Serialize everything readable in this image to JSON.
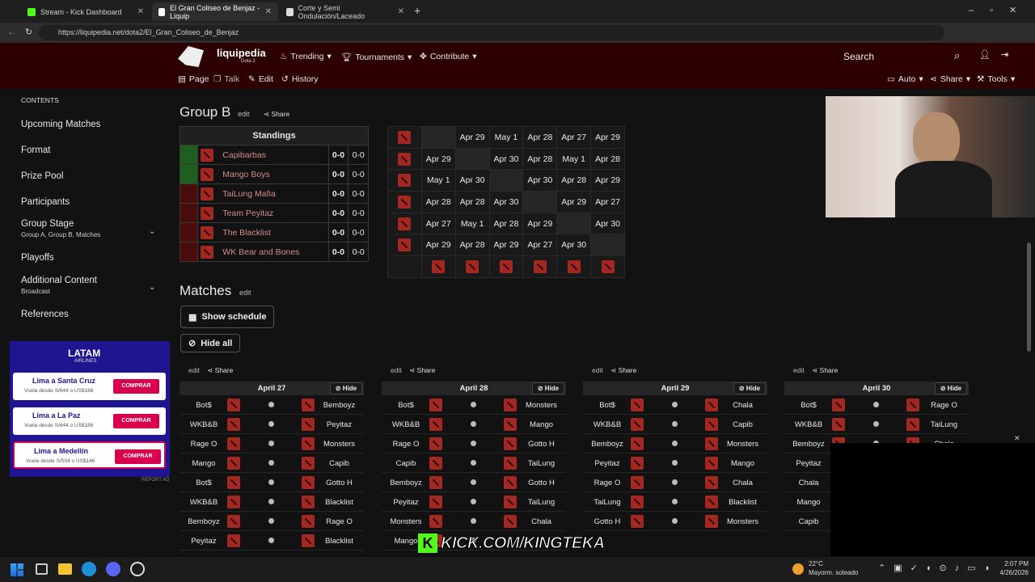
{
  "browser": {
    "tabs": [
      "Stream - Kick Dashboard",
      "El Gran Coliseo de Benjaz - Liquip",
      "Corte y Semi Ondulación/Laceado"
    ],
    "url": "https://liquipedia.net/dota2/El_Gran_Coliseo_de_Benjaz"
  },
  "header": {
    "logo": "liquipedia",
    "logo_sub": "Dota 2",
    "nav": [
      "Trending",
      "Tournaments",
      "Contribute"
    ],
    "search": "Search",
    "page_tabs": [
      "Page",
      "Talk",
      "Edit",
      "History"
    ],
    "right_tools": [
      "Auto",
      "Share",
      "Tools"
    ]
  },
  "sidebar": {
    "title": "CONTENTS",
    "items": [
      {
        "label": "Upcoming Matches"
      },
      {
        "label": "Format"
      },
      {
        "label": "Prize Pool"
      },
      {
        "label": "Participants"
      },
      {
        "label": "Group Stage",
        "sub": "Group A, Group B, Matches"
      },
      {
        "label": "Playoffs"
      },
      {
        "label": "Additional Content",
        "sub": "Broadcast"
      },
      {
        "label": "References"
      }
    ]
  },
  "ad": {
    "brand": "LATAM",
    "brand_sub": "AIRLINES",
    "rows": [
      {
        "name": "Lima a Santa Cruz",
        "price": "Vuela desde S/644 o US$186",
        "cta": "COMPRAR"
      },
      {
        "name": "Lima a La Paz",
        "price": "Vuela desde S/644 o US$186",
        "cta": "COMPRAR"
      },
      {
        "name": "Lima a Medellín",
        "price": "Vuela desde S/504 o US$146",
        "cta": "COMPRAR"
      }
    ],
    "report": "REPORT AD"
  },
  "group": {
    "title": "Group B",
    "edit": "edit",
    "share": "Share",
    "standings_header": "Standings",
    "teams": [
      {
        "name": "Capibarbas",
        "score": "0-0",
        "maps": "0-0",
        "color": "#1e5e1e"
      },
      {
        "name": "Mango Boys",
        "score": "0-0",
        "maps": "0-0",
        "color": "#1e5e1e"
      },
      {
        "name": "TaiLung Mafia",
        "score": "0-0",
        "maps": "0-0",
        "color": "#4a0b0b"
      },
      {
        "name": "Team Peyitaz",
        "score": "0-0",
        "maps": "0-0",
        "color": "#4a0b0b"
      },
      {
        "name": "The Blacklist",
        "score": "0-0",
        "maps": "0-0",
        "color": "#4a0b0b"
      },
      {
        "name": "WK Bear and Bones",
        "score": "0-0",
        "maps": "0-0",
        "color": "#4a0b0b"
      }
    ]
  },
  "crosstable": [
    [
      "",
      "Apr 29",
      "May 1",
      "Apr 28",
      "Apr 27",
      "Apr 29"
    ],
    [
      "Apr 29",
      "",
      "Apr 30",
      "Apr 28",
      "May 1",
      "Apr 28"
    ],
    [
      "May 1",
      "Apr 30",
      "",
      "Apr 30",
      "Apr 28",
      "Apr 29"
    ],
    [
      "Apr 28",
      "Apr 28",
      "Apr 30",
      "",
      "Apr 29",
      "Apr 27"
    ],
    [
      "Apr 27",
      "May 1",
      "Apr 28",
      "Apr 29",
      "",
      "Apr 30"
    ],
    [
      "Apr 29",
      "Apr 28",
      "Apr 29",
      "Apr 27",
      "Apr 30",
      ""
    ]
  ],
  "matches": {
    "title": "Matches",
    "edit": "edit",
    "show_schedule": "Show schedule",
    "hide_all": "Hide all",
    "hide": "Hide",
    "days": [
      {
        "date": "April 27",
        "rows": [
          [
            "Bot$",
            "Bemboyz"
          ],
          [
            "WKB&B",
            "Peyitaz"
          ],
          [
            "Rage O",
            "Monsters"
          ],
          [
            "Mango",
            "Capib"
          ],
          [
            "Bot$",
            "Gotto H"
          ],
          [
            "WKB&B",
            "Blacklist"
          ],
          [
            "Bemboyz",
            "Rage O"
          ],
          [
            "Peyitaz",
            "Blacklist"
          ]
        ]
      },
      {
        "date": "April 28",
        "rows": [
          [
            "Bot$",
            "Monsters"
          ],
          [
            "WKB&B",
            "Mango"
          ],
          [
            "Rage O",
            "Gotto H"
          ],
          [
            "Capib",
            "TaiLung"
          ],
          [
            "Bemboyz",
            "Gotto H"
          ],
          [
            "Peyitaz",
            "TaiLung"
          ],
          [
            "Monsters",
            "Chala"
          ],
          [
            "Mango",
            ""
          ]
        ]
      },
      {
        "date": "April 29",
        "rows": [
          [
            "Bot$",
            "Chala"
          ],
          [
            "WKB&B",
            "Capib"
          ],
          [
            "Bemboyz",
            "Monsters"
          ],
          [
            "Peyitaz",
            "Mango"
          ],
          [
            "Rage O",
            "Chala"
          ],
          [
            "TaiLung",
            "Blacklist"
          ],
          [
            "Gotto H",
            "Monsters"
          ]
        ]
      },
      {
        "date": "April 30",
        "rows": [
          [
            "Bot$",
            "Rage O"
          ],
          [
            "WKB&B",
            "TaiLung"
          ],
          [
            "Bemboyz",
            "Chala"
          ],
          [
            "Peyitaz",
            ""
          ],
          [
            "Chala",
            ""
          ],
          [
            "Mango",
            ""
          ],
          [
            "Capib",
            ""
          ]
        ]
      }
    ]
  },
  "overlay": {
    "kick": "KICK.COM/KINGTEKA"
  },
  "taskbar": {
    "temp": "22°C",
    "weather": "Mayorm. soleado",
    "time": "2:07 PM",
    "date": "4/26/2026"
  }
}
